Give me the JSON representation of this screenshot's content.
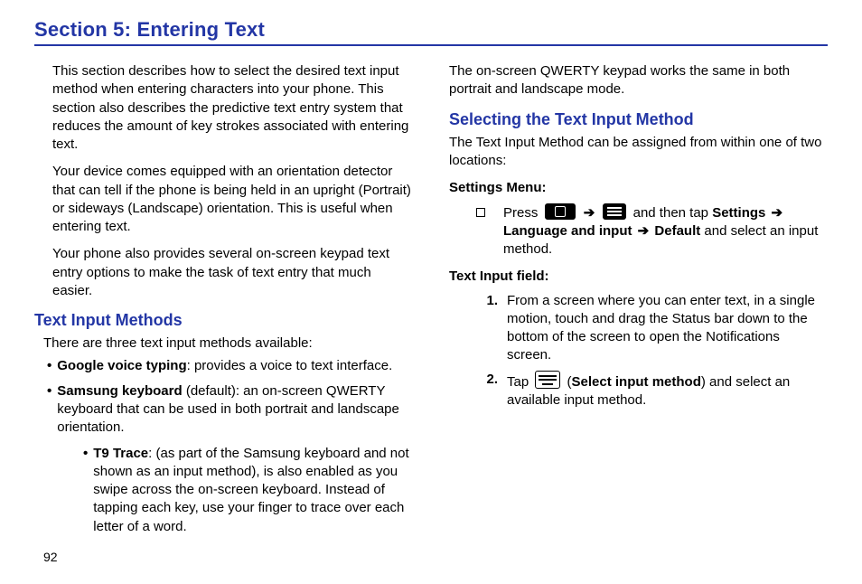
{
  "section_title": "Section 5: Entering Text",
  "page_number": "92",
  "col1": {
    "intro1": "This section describes how to select the desired text input method when entering characters into your phone. This section also describes the predictive text entry system that reduces the amount of key strokes associated with entering text.",
    "intro2": "Your device comes equipped with an orientation detector that can tell if the phone is being held in an upright (Portrait) or sideways (Landscape) orientation. This is useful when entering text.",
    "intro3": "Your phone also provides several on-screen keypad text entry options to make the task of text entry that much easier.",
    "h2": "Text Input Methods",
    "lead_in": "There are three text input methods available:",
    "b1_bold": "Google voice typing",
    "b1_rest": ": provides a voice to text interface.",
    "b2_bold": "Samsung keyboard",
    "b2_rest": " (default): an on-screen QWERTY keyboard that can be used in both portrait and landscape orientation.",
    "b2a_bold": "T9 Trace",
    "b2a_rest": ": (as part of the Samsung keyboard and not shown as an input method), is also enabled as you swipe across the on-screen keyboard. Instead of tapping each key, use your finger to trace over each letter of a word."
  },
  "col2": {
    "top_p": "The on-screen QWERTY keypad works the same in both portrait and landscape mode.",
    "h2": "Selecting the Text Input Method",
    "lead_in": "The Text Input Method can be assigned from within one of two locations:",
    "sub1": "Settings Menu:",
    "sm_press": "Press ",
    "sm_then": " and then tap ",
    "sm_settings": "Settings ",
    "sm_lang": "Language and input ",
    "sm_default": " Default",
    "sm_rest": " and select an input method.",
    "sub2": "Text Input field:",
    "step1": "From a screen where you can enter text, in a single motion, touch and drag the Status bar down to the bottom of the screen to open the Notifications screen.",
    "step2_tap": "Tap ",
    "step2_select": "Select input method",
    "step2_rest": ") and select an available input method.",
    "step1_num": "1.",
    "step2_num": "2.",
    "arrow": "➔"
  }
}
